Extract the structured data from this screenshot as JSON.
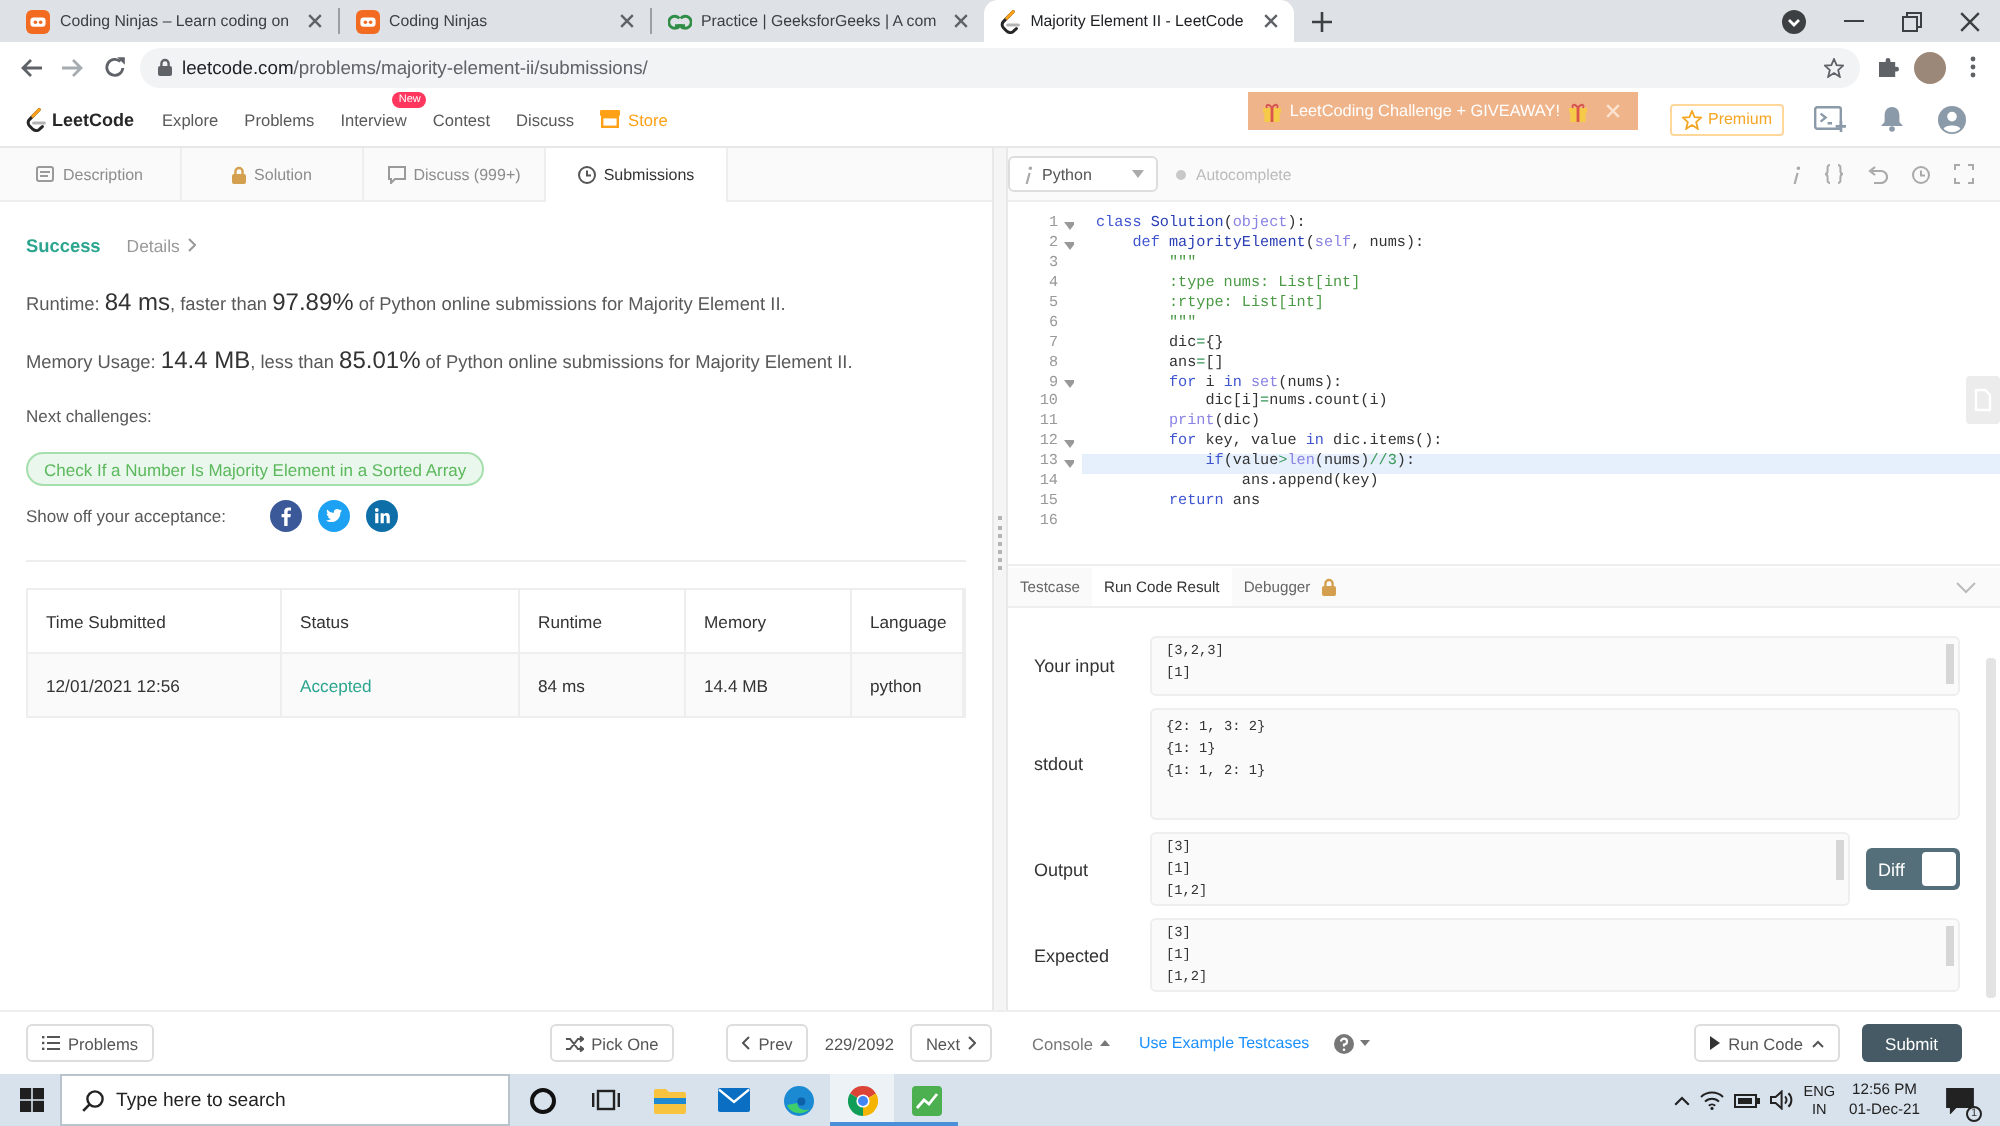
{
  "browser": {
    "tabs": [
      {
        "kind": "ninjas",
        "title": "Coding Ninjas – Learn coding on",
        "selected": false
      },
      {
        "kind": "ninjas",
        "title": "Coding Ninjas",
        "selected": false
      },
      {
        "kind": "gfg",
        "title": "Practice | GeeksforGeeks | A com",
        "selected": false
      },
      {
        "kind": "leetcode",
        "title": "Majority Element II - LeetCode",
        "selected": true
      }
    ],
    "address": {
      "host": "leetcode.com",
      "path": "/problems/majority-element-ii/submissions/"
    }
  },
  "site_nav": {
    "logo": "LeetCode",
    "links": [
      {
        "label": "Explore",
        "kind": "plain"
      },
      {
        "label": "Problems",
        "kind": "plain"
      },
      {
        "label": "Interview",
        "kind": "plain",
        "badge": "New"
      },
      {
        "label": "Contest",
        "kind": "plain"
      },
      {
        "label": "Discuss",
        "kind": "plain"
      },
      {
        "label": "Store",
        "kind": "store"
      }
    ],
    "banner": "LeetCoding Challenge + GIVEAWAY!",
    "premium": "Premium"
  },
  "left_panel": {
    "tabs": [
      {
        "label": "Description",
        "kind": "description",
        "selected": false
      },
      {
        "label": "Solution",
        "kind": "solution",
        "selected": false
      },
      {
        "label": "Discuss (999+)",
        "kind": "discuss",
        "selected": false
      },
      {
        "label": "Submissions",
        "kind": "submissions",
        "selected": true
      }
    ],
    "result": {
      "status": "Success",
      "details": "Details",
      "stats": [
        {
          "label": "Runtime: ",
          "value": "84 ms",
          "comparison": ", faster than ",
          "percent": "97.89%",
          "suffix": " of Python online submissions for Majority Element II."
        },
        {
          "label": "Memory Usage: ",
          "value": "14.4 MB",
          "comparison": ", less than ",
          "percent": "85.01%",
          "suffix": " of Python online submissions for Majority Element II."
        }
      ],
      "next_label": "Next challenges:",
      "challenges": [
        "Check If a Number Is Majority Element in a Sorted Array"
      ],
      "share_label": "Show off your acceptance:",
      "share": [
        {
          "kind": "facebook"
        },
        {
          "kind": "twitter"
        },
        {
          "kind": "linkedin"
        }
      ]
    },
    "table": {
      "columns": [
        "Time Submitted",
        "Status",
        "Runtime",
        "Memory",
        "Language"
      ],
      "rows": [
        {
          "kind": "accepted",
          "time": "12/01/2021 12:56",
          "status": "Accepted",
          "runtime": "84 ms",
          "memory": "14.4 MB",
          "language": "python"
        }
      ]
    }
  },
  "editor": {
    "language": "Python",
    "autocomplete": {
      "label": "Autocomplete",
      "on": false
    },
    "lines": [
      {
        "number": "1",
        "fold": true,
        "active": false,
        "tokens": [
          {
            "text": "class",
            "kind": "keyword"
          },
          {
            "text": " Solution",
            "kind": "definition"
          },
          {
            "text": "(",
            "kind": "plain"
          },
          {
            "text": "object",
            "kind": "builtin"
          },
          {
            "text": "):",
            "kind": "plain"
          }
        ]
      },
      {
        "number": "2",
        "fold": true,
        "active": false,
        "tokens": [
          {
            "text": "    def",
            "kind": "keyword"
          },
          {
            "text": " majorityElement",
            "kind": "definition"
          },
          {
            "text": "(",
            "kind": "plain"
          },
          {
            "text": "self",
            "kind": "builtin"
          },
          {
            "text": ", nums):",
            "kind": "plain"
          }
        ]
      },
      {
        "number": "3",
        "fold": false,
        "active": false,
        "tokens": [
          {
            "text": "        \"\"\"",
            "kind": "string"
          }
        ]
      },
      {
        "number": "4",
        "fold": false,
        "active": false,
        "tokens": [
          {
            "text": "        :type nums: List[int]",
            "kind": "string"
          }
        ]
      },
      {
        "number": "5",
        "fold": false,
        "active": false,
        "tokens": [
          {
            "text": "        :rtype: List[int]",
            "kind": "string"
          }
        ]
      },
      {
        "number": "6",
        "fold": false,
        "active": false,
        "tokens": [
          {
            "text": "        \"\"\"",
            "kind": "string"
          }
        ]
      },
      {
        "number": "7",
        "fold": false,
        "active": false,
        "tokens": [
          {
            "text": "        dic",
            "kind": "plain"
          },
          {
            "text": "=",
            "kind": "operator"
          },
          {
            "text": "{}",
            "kind": "plain"
          }
        ]
      },
      {
        "number": "8",
        "fold": false,
        "active": false,
        "tokens": [
          {
            "text": "        ans",
            "kind": "plain"
          },
          {
            "text": "=",
            "kind": "operator"
          },
          {
            "text": "[]",
            "kind": "plain"
          }
        ]
      },
      {
        "number": "9",
        "fold": true,
        "active": false,
        "tokens": [
          {
            "text": "        for",
            "kind": "keyword"
          },
          {
            "text": " i ",
            "kind": "plain"
          },
          {
            "text": "in",
            "kind": "keyword"
          },
          {
            "text": " set",
            "kind": "builtin"
          },
          {
            "text": "(nums):",
            "kind": "plain"
          }
        ]
      },
      {
        "number": "10",
        "fold": false,
        "active": false,
        "tokens": [
          {
            "text": "            dic[i]",
            "kind": "plain"
          },
          {
            "text": "=",
            "kind": "operator"
          },
          {
            "text": "nums.count(i)",
            "kind": "plain"
          }
        ]
      },
      {
        "number": "11",
        "fold": false,
        "active": false,
        "tokens": [
          {
            "text": "        print",
            "kind": "builtin"
          },
          {
            "text": "(dic)",
            "kind": "plain"
          }
        ]
      },
      {
        "number": "12",
        "fold": true,
        "active": false,
        "tokens": [
          {
            "text": "        for",
            "kind": "keyword"
          },
          {
            "text": " key, value ",
            "kind": "plain"
          },
          {
            "text": "in",
            "kind": "keyword"
          },
          {
            "text": " dic.items():",
            "kind": "plain"
          }
        ]
      },
      {
        "number": "13",
        "fold": true,
        "active": true,
        "tokens": [
          {
            "text": "            if",
            "kind": "keyword"
          },
          {
            "text": "(value",
            "kind": "plain"
          },
          {
            "text": ">",
            "kind": "operator"
          },
          {
            "text": "len",
            "kind": "builtin"
          },
          {
            "text": "(nums)",
            "kind": "plain"
          },
          {
            "text": "//",
            "kind": "operator"
          },
          {
            "text": "3",
            "kind": "number"
          },
          {
            "text": "):",
            "kind": "plain"
          }
        ]
      },
      {
        "number": "14",
        "fold": false,
        "active": false,
        "tokens": [
          {
            "text": "                ans.append(key)",
            "kind": "plain"
          }
        ]
      },
      {
        "number": "15",
        "fold": false,
        "active": false,
        "tokens": [
          {
            "text": "        return",
            "kind": "keyword"
          },
          {
            "text": " ans",
            "kind": "plain"
          }
        ]
      },
      {
        "number": "16",
        "fold": false,
        "active": false
      }
    ]
  },
  "console": {
    "tabs": [
      {
        "label": "Testcase",
        "selected": false,
        "locked": false
      },
      {
        "label": "Run Code Result",
        "selected": true,
        "locked": false
      },
      {
        "label": "Debugger",
        "selected": false,
        "locked": true
      }
    ],
    "results": [
      {
        "label": "Your input",
        "lines": [
          "[3,2,3]",
          "[1]"
        ]
      },
      {
        "label": "stdout",
        "lines": [
          "{2: 1, 3: 2}",
          "{1: 1}",
          "{1: 1, 2: 1}"
        ]
      },
      {
        "label": "Output",
        "lines": [
          "[3]",
          "[1]",
          "[1,2]"
        ],
        "diff": {
          "label": "Diff",
          "on": true
        }
      },
      {
        "label": "Expected",
        "lines": [
          "[3]",
          "[1]",
          "[1,2]"
        ]
      }
    ]
  },
  "footer": {
    "problems": "Problems",
    "pick_one": "Pick One",
    "prev": "Prev",
    "position": "229/2092",
    "next": "Next",
    "console": "Console",
    "example_testcases": "Use Example Testcases",
    "run": "Run Code",
    "submit": "Submit"
  },
  "taskbar": {
    "search_placeholder": "Type here to search",
    "apps": [
      {
        "kind": "cortana",
        "selected": false,
        "running": false
      },
      {
        "kind": "task_view",
        "selected": false,
        "running": false
      },
      {
        "kind": "explorer",
        "selected": false,
        "running": false
      },
      {
        "kind": "mail",
        "selected": false,
        "running": false
      },
      {
        "kind": "edge",
        "selected": false,
        "running": false
      },
      {
        "kind": "chrome",
        "selected": true,
        "running": true
      },
      {
        "kind": "chart",
        "selected": false,
        "running": true
      }
    ],
    "input_language": "ENG",
    "region": "IN",
    "time": "12:56 PM",
    "date": "01-Dec-21",
    "notifications": "1"
  }
}
